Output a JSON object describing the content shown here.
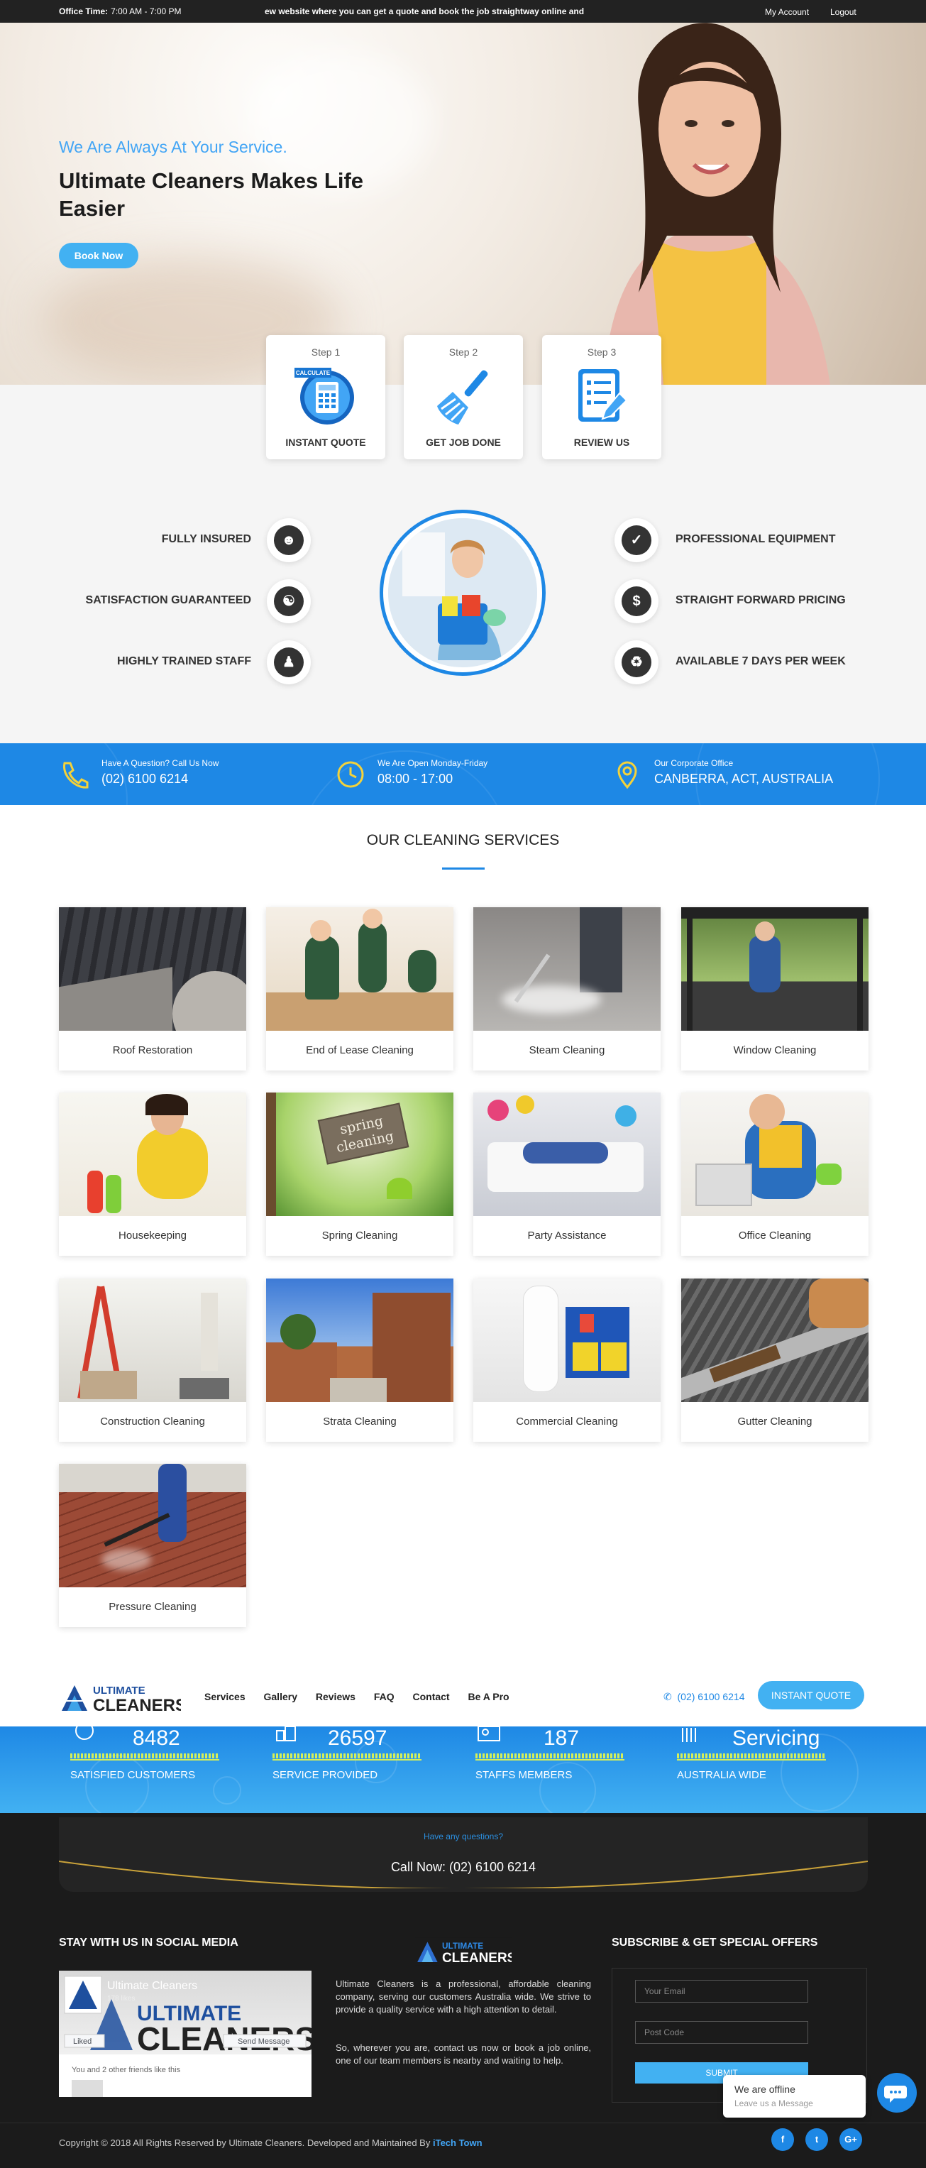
{
  "topbar": {
    "office_label": "Office Time:",
    "office_hours": "7:00 AM - 7:00 PM",
    "ticker": "ew website where you can get a quote and book the job straightway online and",
    "my_account": "My Account",
    "logout": "Logout"
  },
  "hero": {
    "tagline": "We Are Always At Your Service.",
    "title": "Ultimate Cleaners Makes Life Easier",
    "book_now": "Book Now"
  },
  "steps": [
    {
      "step": "Step 1",
      "label": "INSTANT QUOTE",
      "badge": "CALCULATE",
      "icon": "calculator-icon"
    },
    {
      "step": "Step 2",
      "label": "GET JOB DONE",
      "icon": "broom-icon"
    },
    {
      "step": "Step 3",
      "label": "REVIEW US",
      "icon": "review-form-icon"
    }
  ],
  "features_left": [
    {
      "label": "FULLY INSURED",
      "icon": "user-shield-icon"
    },
    {
      "label": "SATISFACTION GUARANTEED",
      "icon": "handshake-icon"
    },
    {
      "label": "HIGHLY TRAINED STAFF",
      "icon": "team-icon"
    }
  ],
  "features_right": [
    {
      "label": "PROFESSIONAL EQUIPMENT",
      "icon": "check-icon"
    },
    {
      "label": "STRAIGHT FORWARD PRICING",
      "icon": "dollar-icon"
    },
    {
      "label": "AVAILABLE 7 DAYS PER WEEK",
      "icon": "recycle-icon"
    }
  ],
  "contact": [
    {
      "label": "Have A Question? Call Us Now",
      "value": "(02) 6100 6214",
      "icon": "phone-icon"
    },
    {
      "label": "We Are Open Monday-Friday",
      "value": "08:00 - 17:00",
      "icon": "clock-icon"
    },
    {
      "label": "Our Corporate Office",
      "value": "CANBERRA, ACT, AUSTRALIA",
      "icon": "location-pin-icon"
    }
  ],
  "services": {
    "title": "OUR CLEANING SERVICES",
    "items": [
      "Roof Restoration",
      "End of Lease Cleaning",
      "Steam Cleaning",
      "Window Cleaning",
      "Housekeeping",
      "Spring Cleaning",
      "Party Assistance",
      "Office Cleaning",
      "Construction Cleaning",
      "Strata Cleaning",
      "Commercial Cleaning",
      "Gutter Cleaning",
      "Pressure Cleaning"
    ],
    "spring_sign": "spring cleaning"
  },
  "logo": {
    "line1": "ULTIMATE",
    "line2": "CLEANERS"
  },
  "nav": {
    "items": [
      "Services",
      "Gallery",
      "Reviews",
      "FAQ",
      "Contact",
      "Be A Pro"
    ],
    "phone": "(02) 6100 6214",
    "instant_quote": "INSTANT QUOTE"
  },
  "stats": [
    {
      "value": "8482",
      "label": "SATISFIED CUSTOMERS"
    },
    {
      "value": "26597",
      "label": "SERVICE PROVIDED"
    },
    {
      "value": "187",
      "label": "STAFFS MEMBERS"
    },
    {
      "value": "Servicing",
      "label": "AUSTRALIA WIDE"
    }
  ],
  "question": {
    "small": "Have any questions?",
    "call": "Call Now: (02) 6100 6214"
  },
  "footer": {
    "social_title": "STAY WITH US IN SOCIAL MEDIA",
    "fb_page": "Ultimate Cleaners",
    "fb_likes": "178 likes",
    "fb_liked": "Liked",
    "fb_send": "Send Message",
    "fb_friends": "You and 2 other friends like this",
    "about1": "Ultimate Cleaners is a professional, affordable cleaning company, serving our customers Australia wide. We strive to provide a quality service with a high attention to detail.",
    "about2": "So, wherever you are, contact us now or book a job online, one of our team members is nearby and waiting to help.",
    "subscribe_title": "SUBSCRIBE & GET SPECIAL OFFERS",
    "email_ph": "Your Email",
    "postcode_ph": "Post Code",
    "submit": "SUBMIT",
    "copyright": "Copyright © 2018 All Rights Reserved by Ultimate Cleaners. Developed and Maintained By",
    "dev": "iTech Town",
    "social": [
      "f",
      "t",
      "G+"
    ]
  },
  "chat": {
    "status": "We are offline",
    "prompt": "Leave us a Message"
  },
  "colors": {
    "accent": "#1e88e5",
    "light_accent": "#42b1f2",
    "dark": "#1b1b1b",
    "stat_underline": "#d4ef5a"
  }
}
